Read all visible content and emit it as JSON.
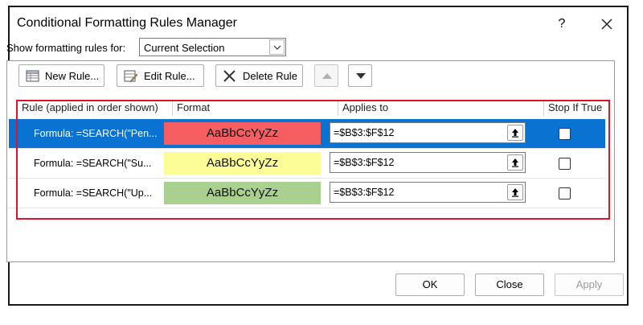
{
  "dialog": {
    "title": "Conditional Formatting Rules Manager",
    "help_label": "?",
    "show_rules_label": "Show formatting rules for:",
    "show_rules_value": "Current Selection"
  },
  "toolbar": {
    "new_rule": "New Rule...",
    "edit_rule": "Edit Rule...",
    "delete_rule": "Delete Rule"
  },
  "grid": {
    "headers": {
      "rule": "Rule (applied in order shown)",
      "format": "Format",
      "applies_to": "Applies to",
      "stop_if_true": "Stop If True"
    },
    "rows": [
      {
        "rule": "Formula: =SEARCH(\"Pen...",
        "format_preview": "AaBbCcYyZz",
        "format_color": "#f75e62",
        "applies_to": "=$B$3:$F$12",
        "stop_if_true": false,
        "selected": true
      },
      {
        "rule": "Formula: =SEARCH(\"Su...",
        "format_preview": "AaBbCcYyZz",
        "format_color": "#fdfd97",
        "applies_to": "=$B$3:$F$12",
        "stop_if_true": false,
        "selected": false
      },
      {
        "rule": "Formula: =SEARCH(\"Up...",
        "format_preview": "AaBbCcYyZz",
        "format_color": "#a9d08e",
        "applies_to": "=$B$3:$F$12",
        "stop_if_true": false,
        "selected": false
      }
    ]
  },
  "buttons": {
    "ok": "OK",
    "close": "Close",
    "apply": "Apply"
  },
  "colors": {
    "selection": "#0a73d1",
    "highlight_frame": "#d9152d"
  }
}
